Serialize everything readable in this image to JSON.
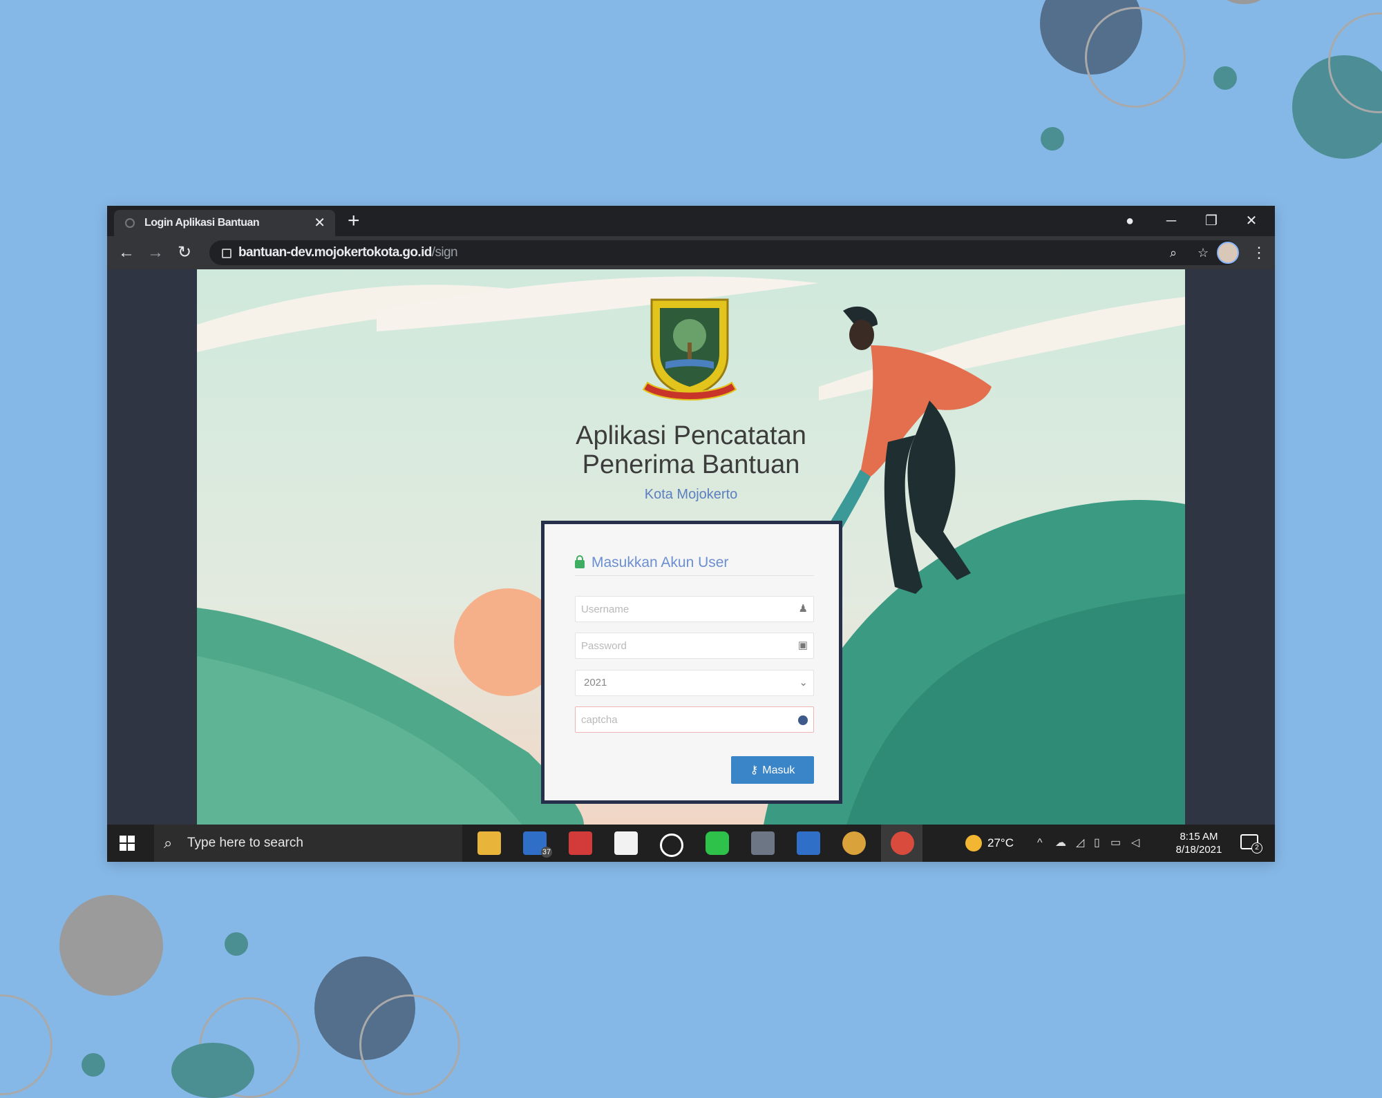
{
  "browser": {
    "tab_title": "Login Aplikasi Bantuan",
    "tab_close": "✕",
    "new_tab": "+",
    "url_domain": "bantuan-dev.mojokertokota.go.id",
    "url_path": "/sign"
  },
  "app": {
    "title_line1": "Aplikasi Pencatatan",
    "title_line2": "Penerima Bantuan",
    "subtitle": "Kota Mojokerto"
  },
  "login": {
    "heading": "Masukkan Akun User",
    "username_placeholder": "Username",
    "password_placeholder": "Password",
    "year_value": "2021",
    "captcha_placeholder": "captcha",
    "submit_label": "Masuk"
  },
  "taskbar": {
    "search_placeholder": "Type here to search",
    "mail_badge": "37",
    "temperature": "27°C",
    "time": "8:15 AM",
    "date": "8/18/2021",
    "notification_count": "2"
  },
  "colors": {
    "background": "#86b8e7",
    "accent_button": "#3a84c8",
    "heading_blue": "#6b8fd0",
    "hill_green": "#3b9a82"
  },
  "icons": {
    "username_field": "user-icon",
    "password_field": "lock-icon",
    "year_field": "chevron-down-icon",
    "captcha_field": "dot-icon",
    "submit": "key-icon"
  }
}
